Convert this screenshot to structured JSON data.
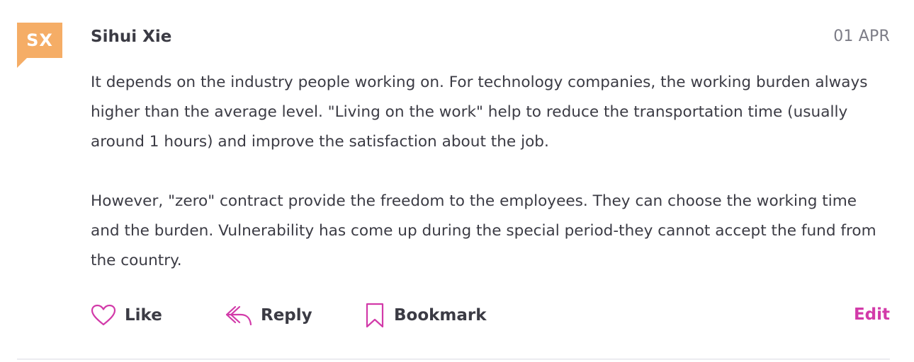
{
  "comment": {
    "avatar_initials": "SX",
    "avatar_color": "#f5ad66",
    "author": "Sihui Xie",
    "date": "01 APR",
    "paragraphs": [
      "It depends on the industry people working on. For technology companies, the working burden always higher than the average level. \"Living on the work\" help to reduce the transportation time (usually around 1 hours) and improve the satisfaction about the job.",
      "However, \"zero\" contract provide the freedom to the employees. They can choose the working time and the burden. Vulnerability has come up during the special period-they cannot accept the fund from the country."
    ]
  },
  "actions": {
    "like_label": "Like",
    "like_icon": "heart-outline-icon",
    "reply_label": "Reply",
    "reply_icon": "reply-arrow-icon",
    "bookmark_label": "Bookmark",
    "bookmark_icon": "bookmark-outline-icon",
    "edit_label": "Edit"
  },
  "colors": {
    "accent": "#d23aa9",
    "text": "#3b3b44",
    "muted": "#7c7c86",
    "divider": "#ececf0"
  }
}
